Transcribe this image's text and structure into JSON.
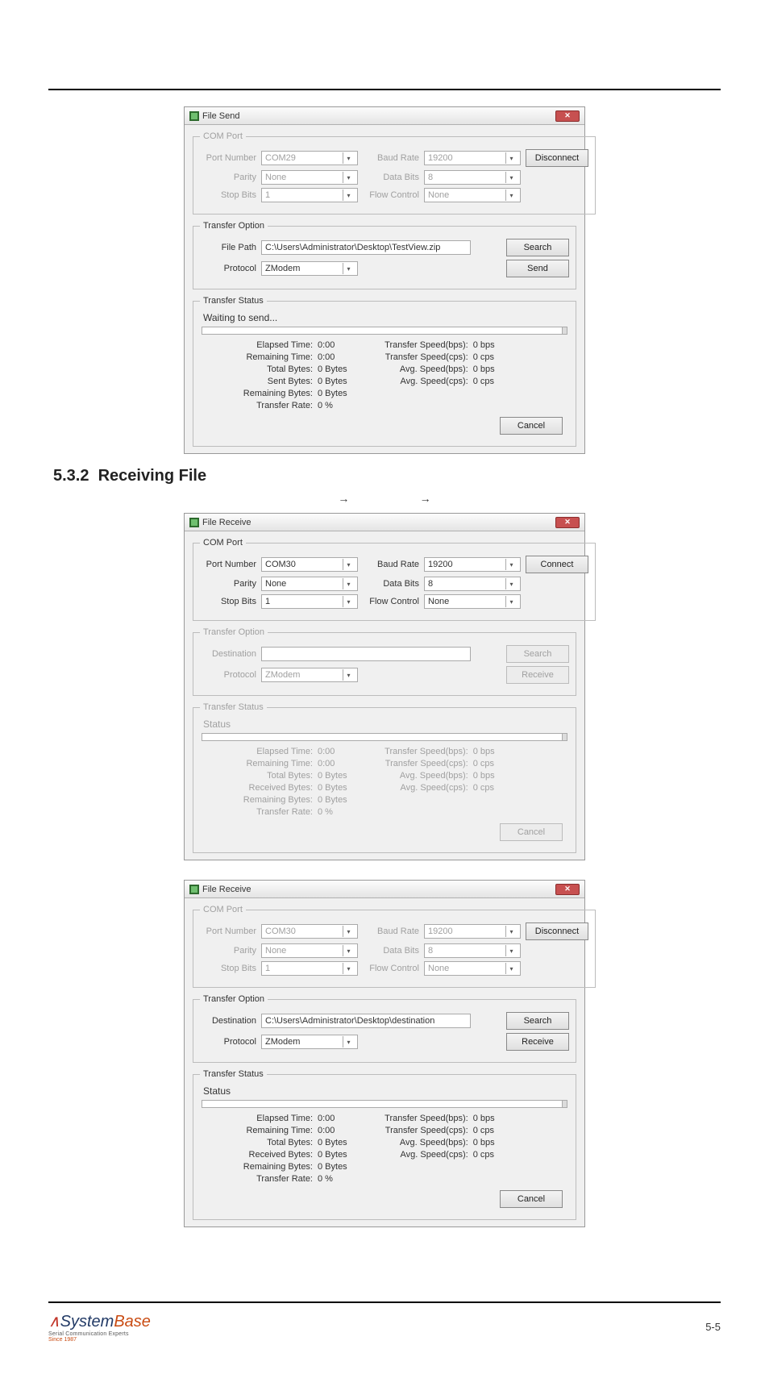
{
  "page": {
    "number": "5-5"
  },
  "section": {
    "number": "5.3.2",
    "title": "Receiving File"
  },
  "branding": {
    "name1": "System",
    "name2": "Base",
    "tag": "Serial Communication Experts",
    "since": "Since 1987"
  },
  "labels": {
    "comPort": "COM Port",
    "transferOption": "Transfer Option",
    "transferStatus": "Transfer Status",
    "portNumber": "Port Number",
    "baudRate": "Baud Rate",
    "parity": "Parity",
    "dataBits": "Data Bits",
    "stopBits": "Stop Bits",
    "flowControl": "Flow Control",
    "filePath": "File Path",
    "destination": "Destination",
    "protocol": "Protocol",
    "search": "Search",
    "send": "Send",
    "receive": "Receive",
    "connect": "Connect",
    "disconnect": "Disconnect",
    "cancel": "Cancel",
    "elapsed": "Elapsed Time:",
    "remainingTime": "Remaining Time:",
    "totalBytes": "Total Bytes:",
    "sentBytes": "Sent Bytes:",
    "receivedBytes": "Received Bytes:",
    "remainingBytes": "Remaining Bytes:",
    "transferRate": "Transfer Rate:",
    "tsBps": "Transfer Speed(bps):",
    "tsCps": "Transfer Speed(cps):",
    "avgBps": "Avg. Speed(bps):",
    "avgCps": "Avg. Speed(cps):"
  },
  "common": {
    "parity": "None",
    "dataBits": "8",
    "stopBits": "1",
    "flowControl": "None",
    "protocol": "ZModem",
    "statsLeft": {
      "elapsed": "0:00",
      "remainingTime": "0:00",
      "totalBytes": "0 Bytes",
      "bytes4": "0 Bytes",
      "remainingBytes": "0 Bytes",
      "transferRate": "0 %"
    },
    "statsRight": {
      "tsBps": "0 bps",
      "tsCps": "0 cps",
      "avgBps": "0 bps",
      "avgCps": "0 cps"
    }
  },
  "dlg1": {
    "title": "File Send",
    "port": "COM29",
    "baud": "19200",
    "filePath": "C:\\Users\\Administrator\\Desktop\\TestView.zip",
    "status": "Waiting to send...",
    "connectLabel": "Disconnect"
  },
  "dlg2": {
    "title": "File Receive",
    "port": "COM30",
    "baud": "19200",
    "destination": "",
    "status": "Status",
    "connectLabel": "Connect"
  },
  "dlg3": {
    "title": "File Receive",
    "port": "COM30",
    "baud": "19200",
    "destination": "C:\\Users\\Administrator\\Desktop\\destination",
    "status": "Status",
    "connectLabel": "Disconnect"
  }
}
